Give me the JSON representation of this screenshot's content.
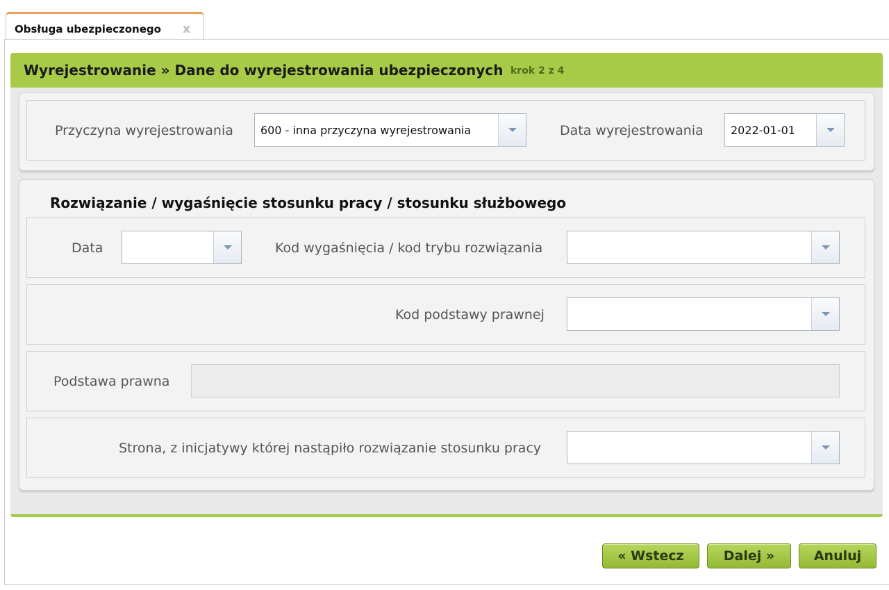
{
  "tab": {
    "label": "Obsługa ubezpieczonego",
    "close": "x"
  },
  "panel": {
    "title": "Wyrejestrowanie » Dane do wyrejestrowania ubezpieczonych",
    "step": "krok 2 z 4"
  },
  "deregistration": {
    "reason_label": "Przyczyna wyrejestrowania",
    "reason_value": "600 - inna przyczyna wyrejestrowania",
    "date_label": "Data wyrejestrowania",
    "date_value": "2022-01-01"
  },
  "termination": {
    "title": "Rozwiązanie / wygaśnięcie stosunku pracy / stosunku służbowego",
    "date_label": "Data",
    "date_value": "",
    "code_label": "Kod wygaśnięcia / kod trybu rozwiązania",
    "code_value": "",
    "legal_code_label": "Kod podstawy prawnej",
    "legal_code_value": "",
    "legal_basis_label": "Podstawa prawna",
    "legal_basis_value": "",
    "initiator_label": "Strona, z inicjatywy której nastąpiło rozwiązanie stosunku pracy",
    "initiator_value": ""
  },
  "buttons": {
    "back": "« Wstecz",
    "next": "Dalej »",
    "cancel": "Anuluj"
  }
}
